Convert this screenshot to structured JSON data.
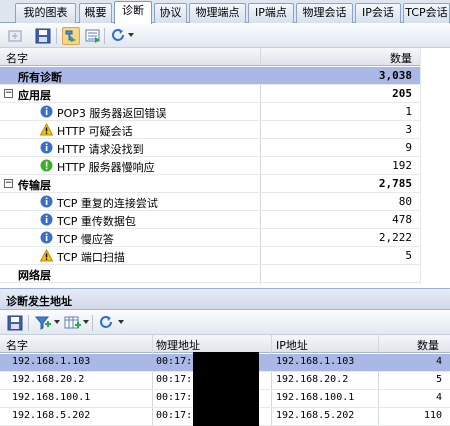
{
  "tabs": [
    {
      "label": "我的图表",
      "active": false
    },
    {
      "label": "概要",
      "active": false
    },
    {
      "label": "诊断",
      "active": true
    },
    {
      "label": "协议",
      "active": false
    },
    {
      "label": "物理端点",
      "active": false
    },
    {
      "label": "IP端点",
      "active": false
    },
    {
      "label": "物理会话",
      "active": false
    },
    {
      "label": "IP会话",
      "active": false
    },
    {
      "label": "TCP会话",
      "active": false
    }
  ],
  "toolbar1": {
    "icons": [
      "export-icon",
      "save-icon",
      "view-tree-icon",
      "view-list-icon",
      "refresh-icon"
    ]
  },
  "diagnosis": {
    "columns": {
      "name": "名字",
      "count": "数量"
    },
    "total": {
      "label": "所有诊断",
      "count": "3,038"
    },
    "groups": [
      {
        "label": "应用层",
        "count": "205",
        "expander": "⊟",
        "items": [
          {
            "label": "POP3 服务器返回错误",
            "count": "1",
            "severity": "info"
          },
          {
            "label": "HTTP 可疑会话",
            "count": "3",
            "severity": "warning"
          },
          {
            "label": "HTTP 请求没找到",
            "count": "9",
            "severity": "info"
          },
          {
            "label": "HTTP 服务器慢响应",
            "count": "192",
            "severity": "ok"
          }
        ]
      },
      {
        "label": "传输层",
        "count": "2,785",
        "expander": "⊟",
        "items": [
          {
            "label": "TCP 重复的连接尝试",
            "count": "80",
            "severity": "info"
          },
          {
            "label": "TCP 重传数据包",
            "count": "478",
            "severity": "info"
          },
          {
            "label": "TCP 慢应答",
            "count": "2,222",
            "severity": "info"
          },
          {
            "label": "TCP 端口扫描",
            "count": "5",
            "severity": "warning"
          }
        ]
      }
    ],
    "partial_next": "网络层"
  },
  "address_panel": {
    "title": "诊断发生地址",
    "columns": {
      "name": "名字",
      "mac": "物理地址",
      "ip": "IP地址",
      "count": "数量"
    },
    "rows": [
      {
        "name": "192.168.1.103",
        "mac": "00:17:",
        "ip": "192.168.1.103",
        "count": "4"
      },
      {
        "name": "192.168.20.2",
        "mac": "00:17:",
        "ip": "192.168.20.2",
        "count": "5"
      },
      {
        "name": "192.168.100.1",
        "mac": "00:17:",
        "ip": "192.168.100.1",
        "count": "4"
      },
      {
        "name": "192.168.5.202",
        "mac": "00:17:",
        "ip": "192.168.5.202",
        "count": "110"
      }
    ]
  },
  "colors": {
    "selection": "#aab8e6",
    "info": "#3a6fc8",
    "warning": "#f2c21b",
    "ok": "#3fae2a"
  }
}
